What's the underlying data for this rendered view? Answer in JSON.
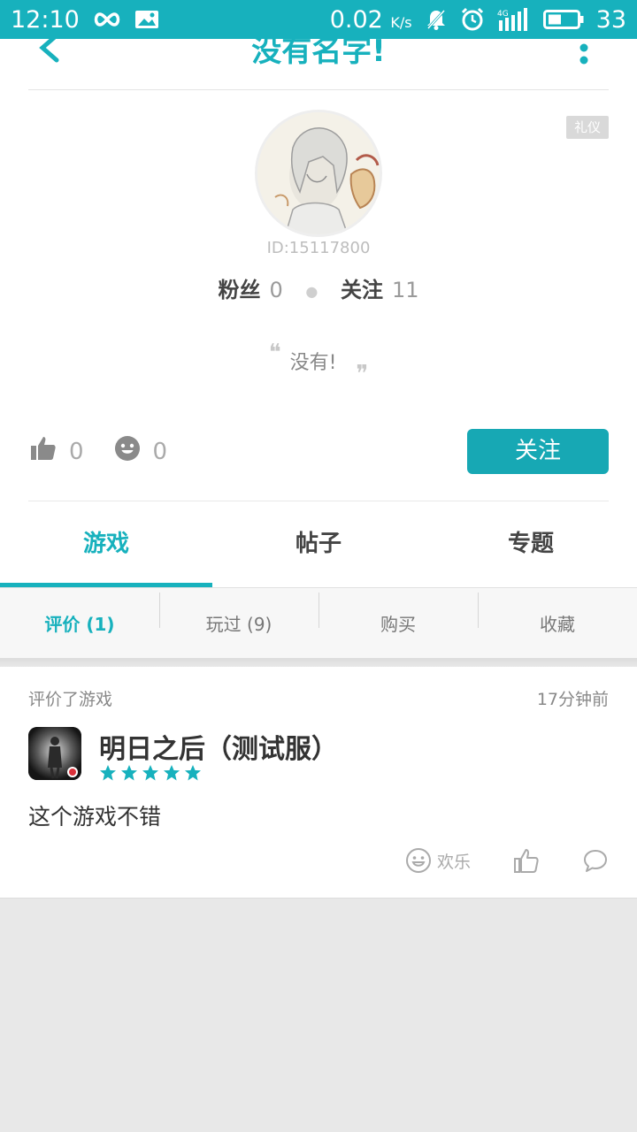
{
  "status_bar": {
    "time": "12:10",
    "speed": "0.02",
    "speed_unit": "K/s",
    "battery": "33",
    "network": "4G"
  },
  "header": {
    "title": "没有名字!"
  },
  "profile": {
    "badge": "礼仪",
    "user_id": "ID:15117800",
    "fans_label": "粉丝",
    "fans_count": "0",
    "following_label": "关注",
    "following_count": "11",
    "bio": "没有!",
    "quote_open": "❝",
    "quote_close": "❞",
    "likes_count": "0",
    "smiles_count": "0",
    "follow_button": "关注"
  },
  "tabs": [
    {
      "label": "游戏",
      "active": true
    },
    {
      "label": "帖子",
      "active": false
    },
    {
      "label": "专题",
      "active": false
    }
  ],
  "subtabs": [
    {
      "label": "评价 (1)",
      "active": true
    },
    {
      "label": "玩过 (9)",
      "active": false
    },
    {
      "label": "购买",
      "active": false
    },
    {
      "label": "收藏",
      "active": false
    }
  ],
  "review": {
    "action": "评价了游戏",
    "time": "17分钟前",
    "game_name": "明日之后（测试服）",
    "rating": 5,
    "text": "这个游戏不错",
    "fun_label": "欢乐"
  },
  "colors": {
    "accent": "#17b1bd",
    "button": "#17a8b4"
  }
}
